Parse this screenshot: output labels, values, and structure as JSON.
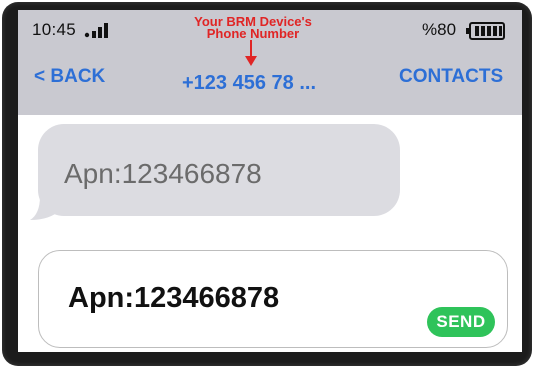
{
  "status_bar": {
    "time": "10:45",
    "battery_text": "%80",
    "battery_level": 0.8,
    "icons": [
      "signal-icon",
      "battery-icon"
    ]
  },
  "annotation": {
    "line1": "Your BRM Device's",
    "line2": "Phone Number",
    "color": "#e02525"
  },
  "nav": {
    "back_label": "< BACK",
    "title": "+123 456 78 ...",
    "contacts_label": "CONTACTS",
    "accent_color": "#2d6fd6"
  },
  "messages": [
    {
      "text": "Apn:123466878"
    }
  ],
  "composer": {
    "value": "Apn:123466878",
    "send_label": "SEND",
    "send_color": "#2fc35a"
  }
}
